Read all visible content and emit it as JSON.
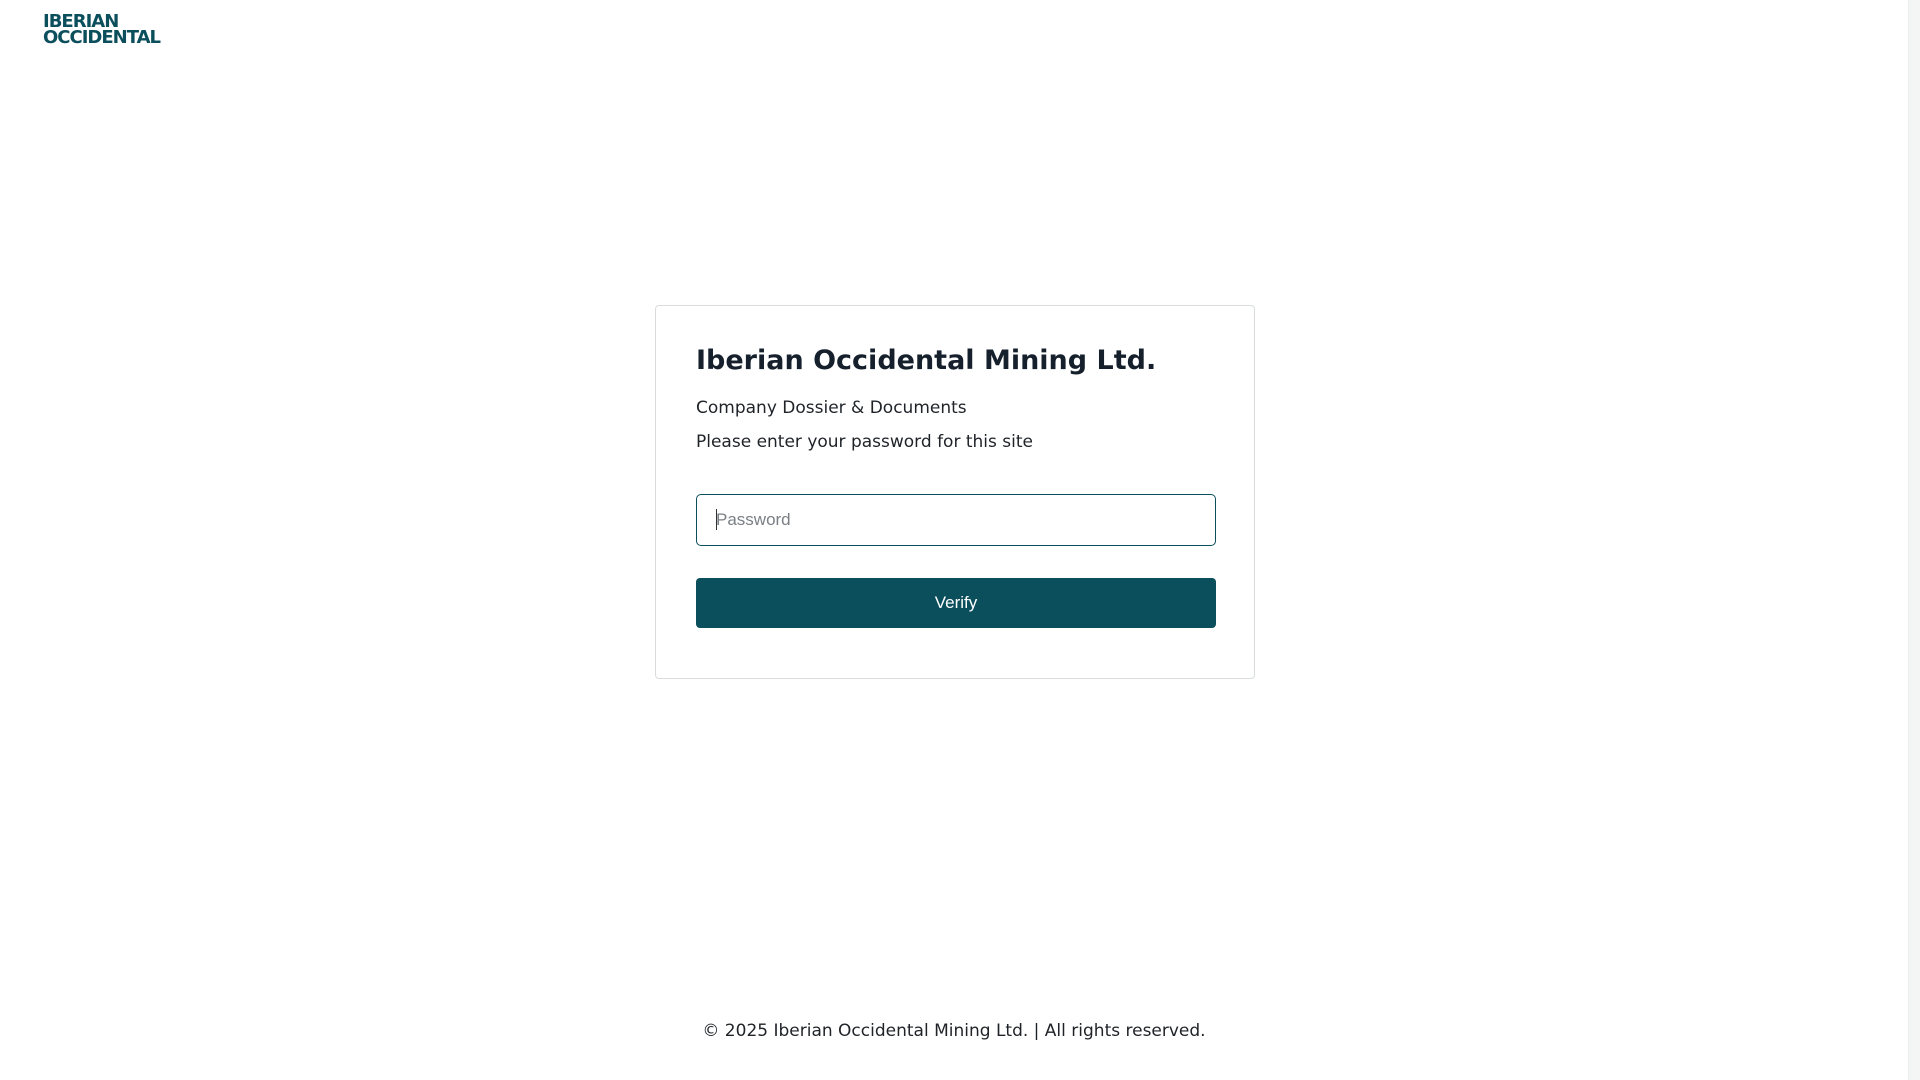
{
  "brand": {
    "logo_line1": "IBERIAN",
    "logo_line2": "OCCIDENTAL",
    "color": "#0b4e5c"
  },
  "login_card": {
    "title": "Iberian Occidental Mining Ltd.",
    "subtitle": "Company Dossier & Documents",
    "prompt": "Please enter your password for this site",
    "password_placeholder": "Password",
    "password_value": "",
    "verify_label": "Verify"
  },
  "footer": {
    "text": "© 2025 Iberian Occidental Mining Ltd. | All rights reserved."
  }
}
